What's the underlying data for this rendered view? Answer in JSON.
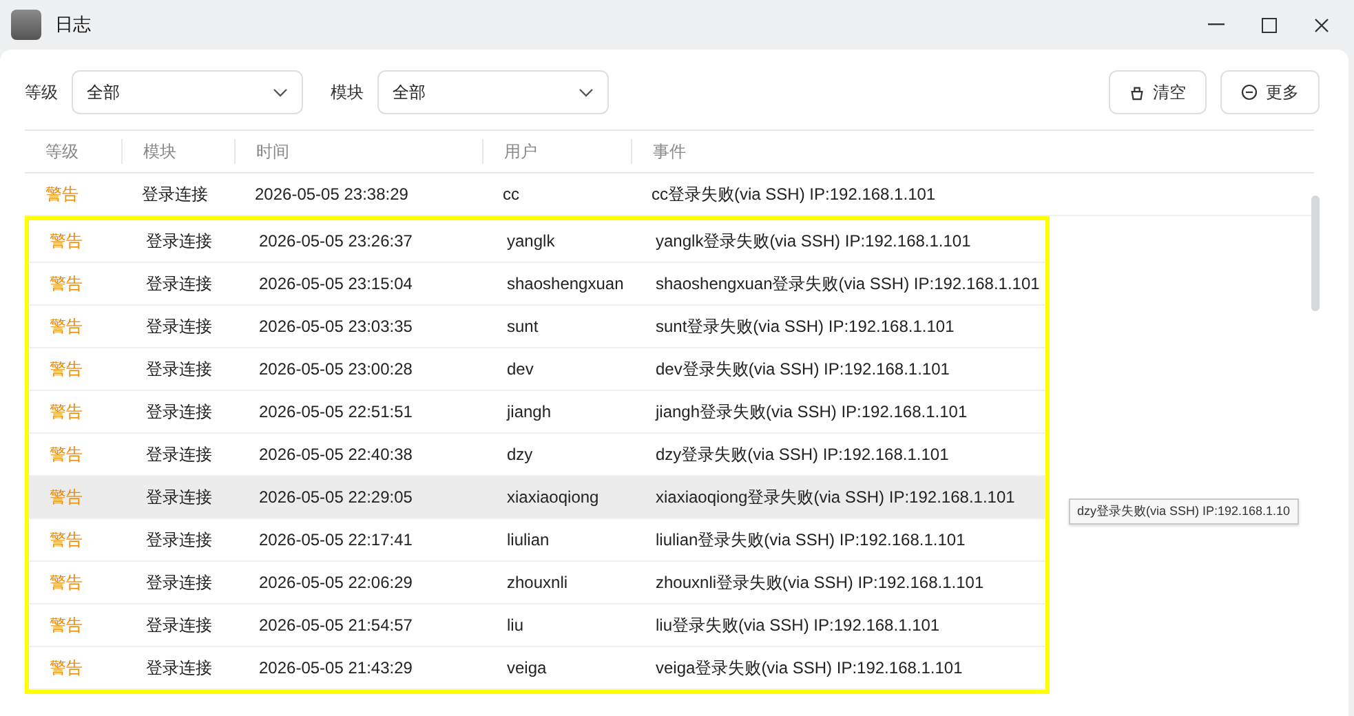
{
  "window": {
    "title": "日志"
  },
  "filters": [
    {
      "label": "等级",
      "value": "全部"
    },
    {
      "label": "模块",
      "value": "全部"
    }
  ],
  "actions": [
    {
      "kind": "clear",
      "label": "清空"
    },
    {
      "kind": "more",
      "label": "更多"
    }
  ],
  "table": {
    "columns": [
      "等级",
      "模块",
      "时间",
      "用户",
      "事件"
    ],
    "rows": [
      {
        "level": "警告",
        "module": "登录连接",
        "time": "2026-05-05 23:38:29",
        "user": "cc",
        "event": "cc登录失败(via SSH) IP:192.168.1.101",
        "selected": false
      },
      {
        "level": "警告",
        "module": "登录连接",
        "time": "2026-05-05 23:26:37",
        "user": "yanglk",
        "event": "yanglk登录失败(via SSH) IP:192.168.1.101",
        "selected": false
      },
      {
        "level": "警告",
        "module": "登录连接",
        "time": "2026-05-05 23:15:04",
        "user": "shaoshengxuan",
        "event": "shaoshengxuan登录失败(via SSH) IP:192.168.1.101",
        "selected": false
      },
      {
        "level": "警告",
        "module": "登录连接",
        "time": "2026-05-05 23:03:35",
        "user": "sunt",
        "event": "sunt登录失败(via SSH) IP:192.168.1.101",
        "selected": false
      },
      {
        "level": "警告",
        "module": "登录连接",
        "time": "2026-05-05 23:00:28",
        "user": "dev",
        "event": "dev登录失败(via SSH) IP:192.168.1.101",
        "selected": false
      },
      {
        "level": "警告",
        "module": "登录连接",
        "time": "2026-05-05 22:51:51",
        "user": "jiangh",
        "event": "jiangh登录失败(via SSH) IP:192.168.1.101",
        "selected": false
      },
      {
        "level": "警告",
        "module": "登录连接",
        "time": "2026-05-05 22:40:38",
        "user": "dzy",
        "event": "dzy登录失败(via SSH) IP:192.168.1.101",
        "selected": false
      },
      {
        "level": "警告",
        "module": "登录连接",
        "time": "2026-05-05 22:29:05",
        "user": "xiaxiaoqiong",
        "event": "xiaxiaoqiong登录失败(via SSH) IP:192.168.1.101",
        "selected": true
      },
      {
        "level": "警告",
        "module": "登录连接",
        "time": "2026-05-05 22:17:41",
        "user": "liulian",
        "event": "liulian登录失败(via SSH) IP:192.168.1.101",
        "selected": false
      },
      {
        "level": "警告",
        "module": "登录连接",
        "time": "2026-05-05 22:06:29",
        "user": "zhouxnli",
        "event": "zhouxnli登录失败(via SSH) IP:192.168.1.101",
        "selected": false
      },
      {
        "level": "警告",
        "module": "登录连接",
        "time": "2026-05-05 21:54:57",
        "user": "liu",
        "event": "liu登录失败(via SSH) IP:192.168.1.101",
        "selected": false
      },
      {
        "level": "警告",
        "module": "登录连接",
        "time": "2026-05-05 21:43:29",
        "user": "veiga",
        "event": "veiga登录失败(via SSH) IP:192.168.1.101",
        "selected": false
      }
    ]
  },
  "tooltip": {
    "text": "dzy登录失败(via SSH) IP:192.168.1.10"
  }
}
